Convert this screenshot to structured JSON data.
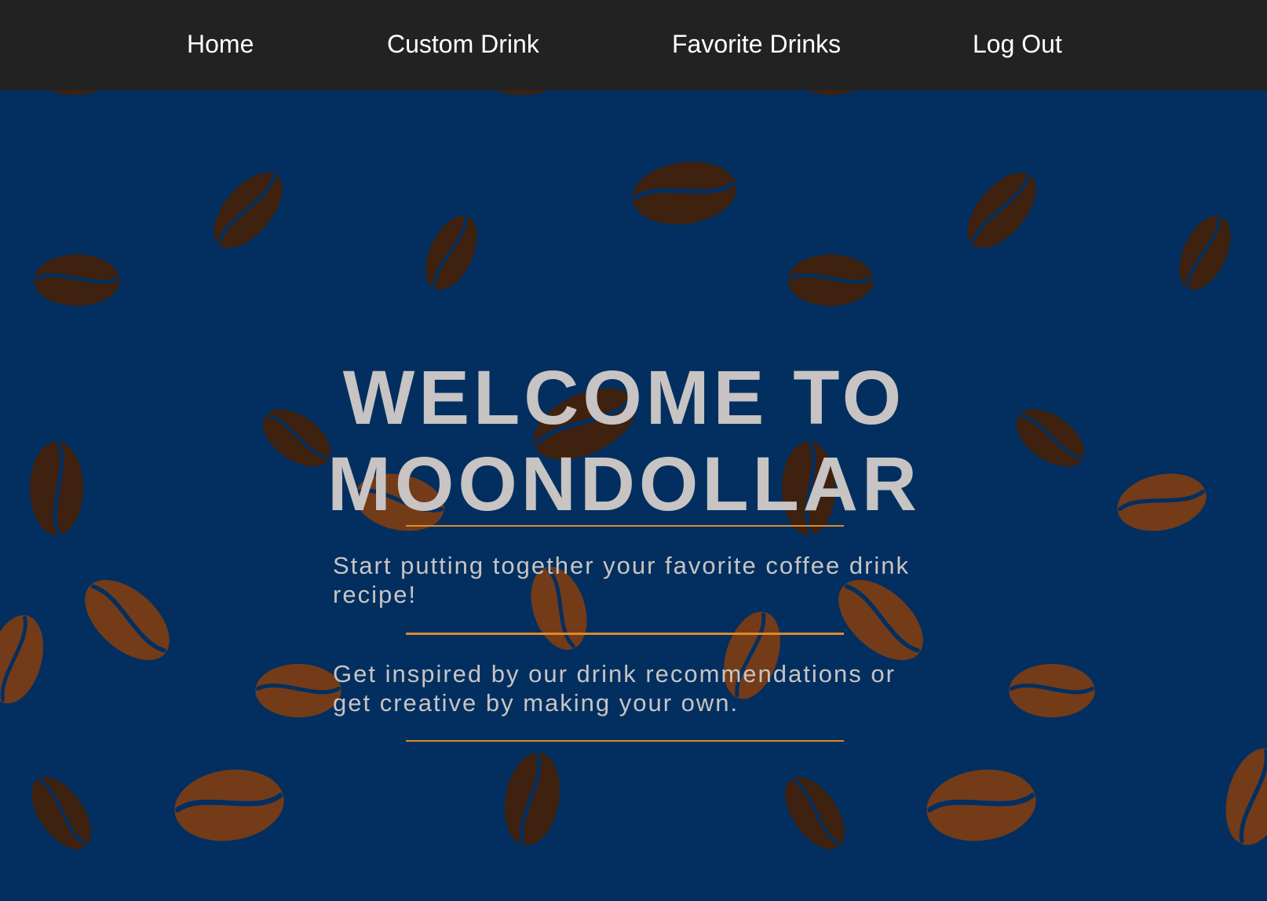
{
  "nav": {
    "home": "Home",
    "custom_drink": "Custom Drink",
    "favorite_drinks": "Favorite Drinks",
    "log_out": "Log Out"
  },
  "hero": {
    "title_line1": "WELCOME TO",
    "title_line2": "MOONDOLLAR",
    "text1": "Start putting together your favorite coffee drink recipe!",
    "text2": "Get inspired by our drink recommendations or get creative by making your own."
  },
  "colors": {
    "navbar_bg": "#222222",
    "page_bg": "#022f5f",
    "bean_dark": "#3e210e",
    "bean_light": "#743b19",
    "accent_rule": "#e0892a",
    "hero_text": "#c7c4c3"
  },
  "background_pattern": "coffee-bean-icon"
}
